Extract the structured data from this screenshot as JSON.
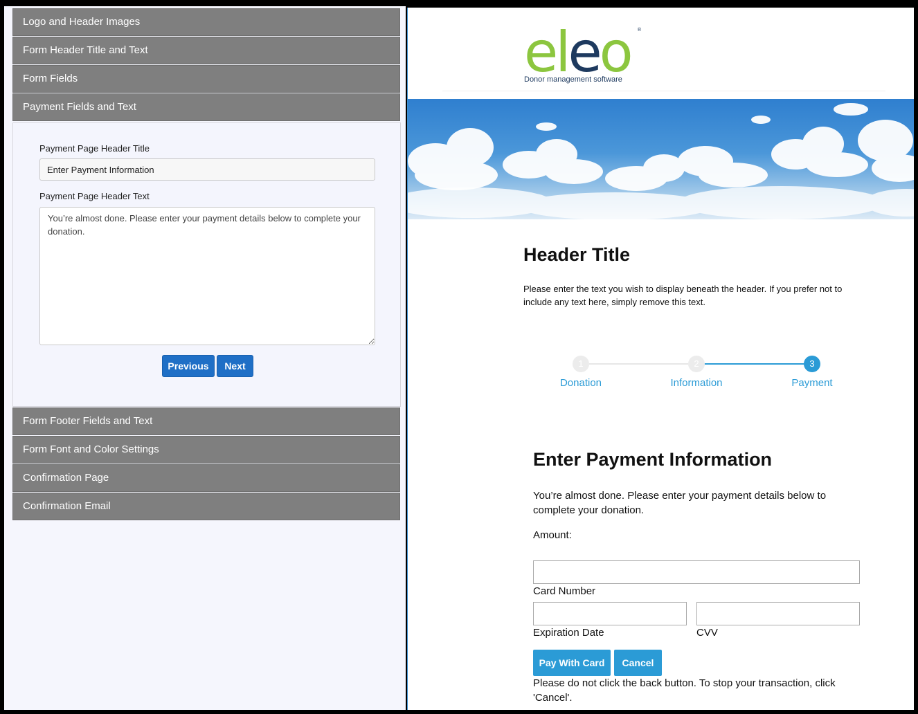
{
  "editor": {
    "sections": [
      "Logo and Header Images",
      "Form Header Title and Text",
      "Form Fields",
      "Payment Fields and Text",
      "Form Footer Fields and Text",
      "Form Font and Color Settings",
      "Confirmation Page",
      "Confirmation Email"
    ],
    "open_section": "Payment Fields and Text",
    "title_label": "Payment Page Header Title",
    "title_value": "Enter Payment Information",
    "text_label": "Payment Page Header Text",
    "text_value": "You’re almost done. Please enter your payment details below to complete your donation.",
    "previous_label": "Previous",
    "next_label": "Next"
  },
  "preview": {
    "logo_text": "eleo",
    "logo_tagline": "Donor management software",
    "header_title": "Header Title",
    "header_text": "Please enter the text you wish to display beneath the header. If you prefer not to include any text here, simply remove this text.",
    "steps": [
      {
        "number": "1",
        "label": "Donation",
        "state": "inactive"
      },
      {
        "number": "2",
        "label": "Information",
        "state": "inactive"
      },
      {
        "number": "3",
        "label": "Payment",
        "state": "active"
      }
    ],
    "payment_title": "Enter Payment Information",
    "payment_text": "You’re almost done. Please enter your payment details below to complete your donation.",
    "amount_label": "Amount:",
    "card_number_label": "Card Number",
    "expiration_label": "Expiration Date",
    "cvv_label": "CVV",
    "pay_button": "Pay With Card",
    "cancel_button": "Cancel",
    "notice": "Please do not click the back button. To stop your transaction, click 'Cancel'."
  },
  "colors": {
    "accordion_header": "#7f7f7f",
    "primary_button": "#1f6fc6",
    "accent": "#2b9bd6",
    "logo_green": "#8cc63f",
    "logo_navy": "#1e3a5f"
  }
}
